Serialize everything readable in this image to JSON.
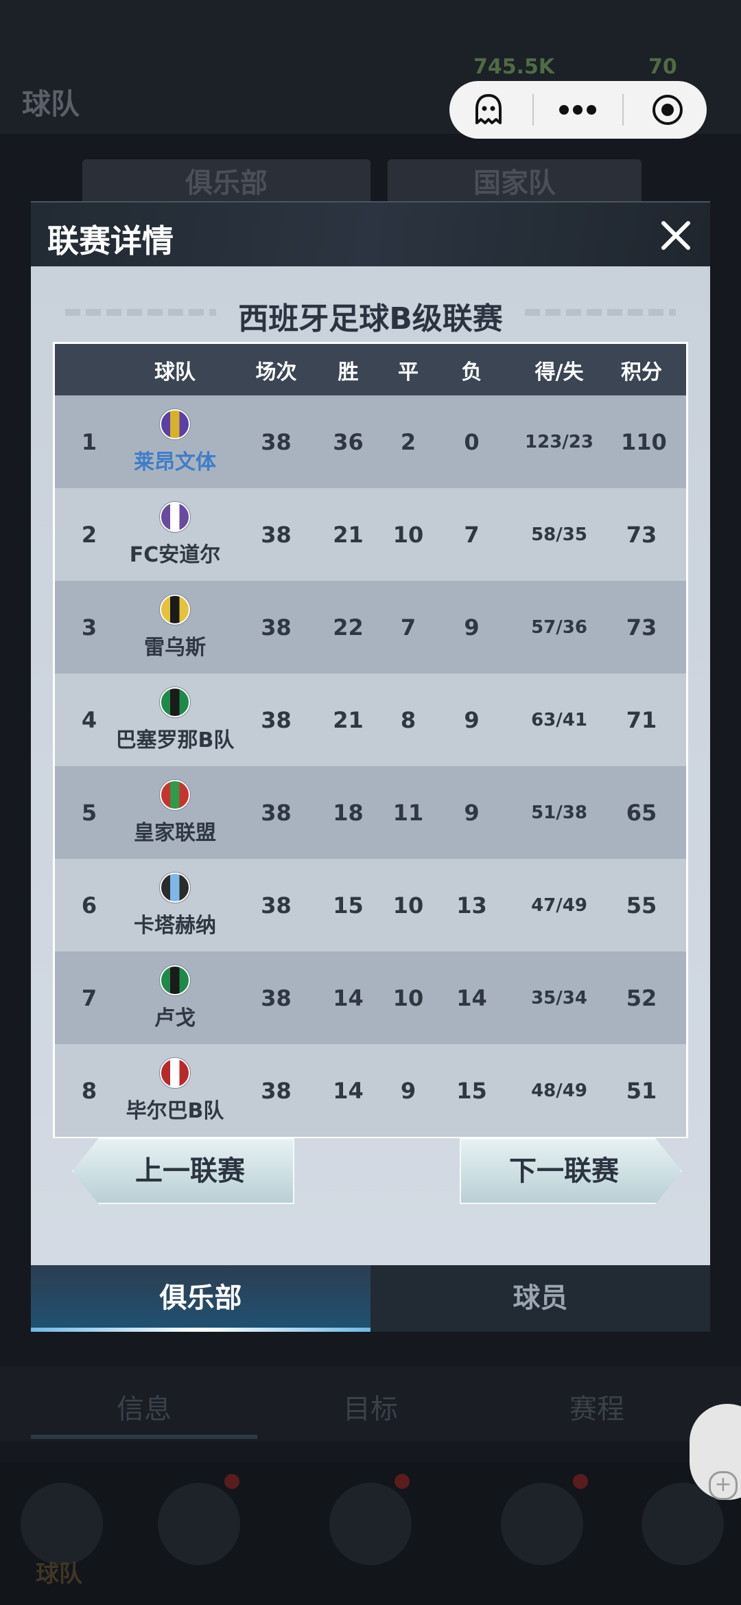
{
  "background": {
    "title": "球队",
    "currency_coins": "745.5K",
    "currency_gems": "70",
    "tabs": [
      "俱乐部",
      "国家队"
    ],
    "info_tabs": [
      "信息",
      "目标",
      "赛程"
    ],
    "bottom_nav_label": "球队"
  },
  "modal": {
    "title": "联赛详情",
    "league_name": "西班牙足球B级联赛",
    "headers": {
      "team": "球队",
      "played": "场次",
      "won": "胜",
      "drawn": "平",
      "lost": "负",
      "goals": "得/失",
      "points": "积分"
    },
    "rows": [
      {
        "rank": "1",
        "team": "莱昂文体",
        "played": "38",
        "won": "36",
        "drawn": "2",
        "lost": "0",
        "goals": "123/23",
        "points": "110",
        "crest_color": "#5b3fa8",
        "crest_color2": "#d7b226"
      },
      {
        "rank": "2",
        "team": "FC安道尔",
        "played": "38",
        "won": "21",
        "drawn": "10",
        "lost": "7",
        "goals": "58/35",
        "points": "73",
        "crest_color": "#6a4aa0",
        "crest_color2": "#ffffff"
      },
      {
        "rank": "3",
        "team": "雷乌斯",
        "played": "38",
        "won": "22",
        "drawn": "7",
        "lost": "9",
        "goals": "57/36",
        "points": "73",
        "crest_color": "#e6c23a",
        "crest_color2": "#1b1b1b"
      },
      {
        "rank": "4",
        "team": "巴塞罗那B队",
        "played": "38",
        "won": "21",
        "drawn": "8",
        "lost": "9",
        "goals": "63/41",
        "points": "71",
        "crest_color": "#1e8a4a",
        "crest_color2": "#1b1b1b"
      },
      {
        "rank": "5",
        "team": "皇家联盟",
        "played": "38",
        "won": "18",
        "drawn": "11",
        "lost": "9",
        "goals": "51/38",
        "points": "65",
        "crest_color": "#c8342d",
        "crest_color2": "#2e9a4a"
      },
      {
        "rank": "6",
        "team": "卡塔赫纳",
        "played": "38",
        "won": "15",
        "drawn": "10",
        "lost": "13",
        "goals": "47/49",
        "points": "55",
        "crest_color": "#2b2b2b",
        "crest_color2": "#7fb7e6"
      },
      {
        "rank": "7",
        "team": "卢戈",
        "played": "38",
        "won": "14",
        "drawn": "10",
        "lost": "14",
        "goals": "35/34",
        "points": "52",
        "crest_color": "#1e8a4a",
        "crest_color2": "#1b1b1b"
      },
      {
        "rank": "8",
        "team": "毕尔巴B队",
        "played": "38",
        "won": "14",
        "drawn": "9",
        "lost": "15",
        "goals": "48/49",
        "points": "51",
        "crest_color": "#b82a2a",
        "crest_color2": "#ffffff"
      }
    ],
    "prev_button": "上一联赛",
    "next_button": "下一联赛",
    "tabs": {
      "club": "俱乐部",
      "players": "球员"
    }
  }
}
